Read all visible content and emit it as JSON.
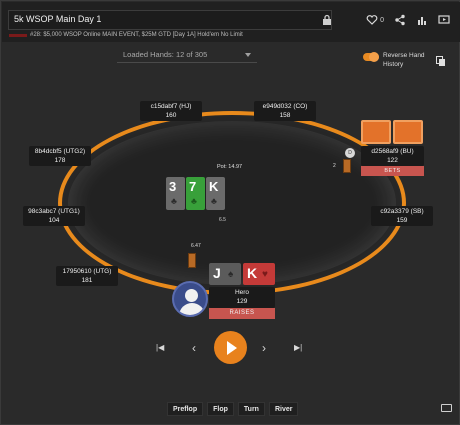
{
  "header": {
    "title": "5k WSOP Main Day 1",
    "subtitle": "#28: $5,000 WSOP Online MAIN EVENT, $25M GTD [Day 1A] Hold'em No Limit",
    "like_count": "0"
  },
  "loaded_hands": "Loaded Hands: 12 of 305",
  "reverse_hand_history": "Reverse Hand History",
  "pot": "Pot: 14.97",
  "pot_chips": "6.5",
  "board": [
    {
      "rank": "3",
      "suit": "♣",
      "color": "#6b6b6b"
    },
    {
      "rank": "7",
      "suit": "♣",
      "color": "#38a03a"
    },
    {
      "rank": "K",
      "suit": "♣",
      "color": "#6b6b6b"
    }
  ],
  "seats": [
    {
      "name": "c15dabf7 (HJ)",
      "stack": "160"
    },
    {
      "name": "e949d032 (CO)",
      "stack": "158"
    },
    {
      "name": "d2568af9 (BU)",
      "stack": "122"
    },
    {
      "name": "8b4dcbf5 (UTG2)",
      "stack": "178"
    },
    {
      "name": "98c3abc7 (UTG1)",
      "stack": "104"
    },
    {
      "name": "c92a3379 (SB)",
      "stack": "159"
    },
    {
      "name": "17950610 (UTG)",
      "stack": "181"
    }
  ],
  "bu": {
    "action": "BETS",
    "bet": "2",
    "dealer": "D"
  },
  "hero": {
    "name": "Hero",
    "stack": "129",
    "action": "RAISES",
    "bet": "6.47",
    "cards": [
      {
        "rank": "J",
        "suit": "♠",
        "color": "#5b5b5b"
      },
      {
        "rank": "K",
        "suit": "♥",
        "color": "#c43a38"
      }
    ]
  },
  "controls": {
    "first": "|◀",
    "prev": "‹",
    "next": "›",
    "last": "▶|"
  },
  "streets": [
    "Preflop",
    "Flop",
    "Turn",
    "River"
  ],
  "colors": {
    "accent": "#e8821d",
    "action_bar": "#c8554f",
    "table_rim": "#e88a1c"
  }
}
